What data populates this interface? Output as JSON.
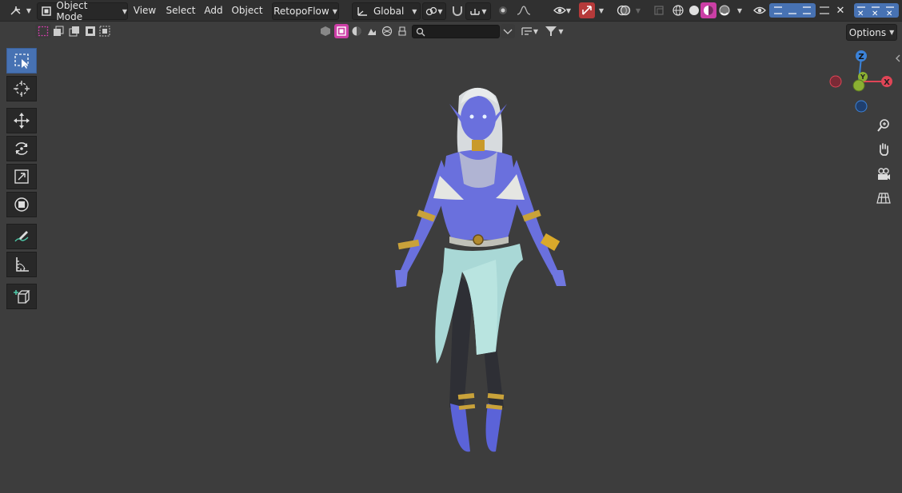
{
  "header": {
    "mode_label": "Object Mode",
    "menus": [
      "View",
      "Select",
      "Add",
      "Object"
    ],
    "addon_label": "RetopoFlow",
    "orientation_label": "Global"
  },
  "subheader": {
    "search_placeholder": "",
    "options_label": "Options"
  },
  "gizmo": {
    "x_label": "X",
    "y_label": "Y",
    "z_label": "Z",
    "x_color": "#e04556",
    "y_color": "#8bb032",
    "z_color": "#3b82d8"
  },
  "toolbar": {
    "tools": [
      "select-box",
      "cursor",
      "move",
      "rotate",
      "scale",
      "transform",
      "annotate",
      "measure",
      "add-cube"
    ],
    "active": "select-box"
  },
  "colors": {
    "viewport_bg": "#3d3d3d",
    "header_bg": "#303030",
    "active_blue": "#4772b3",
    "overlay_red": "#b63a3a",
    "material_pink": "#cc3ea6"
  }
}
